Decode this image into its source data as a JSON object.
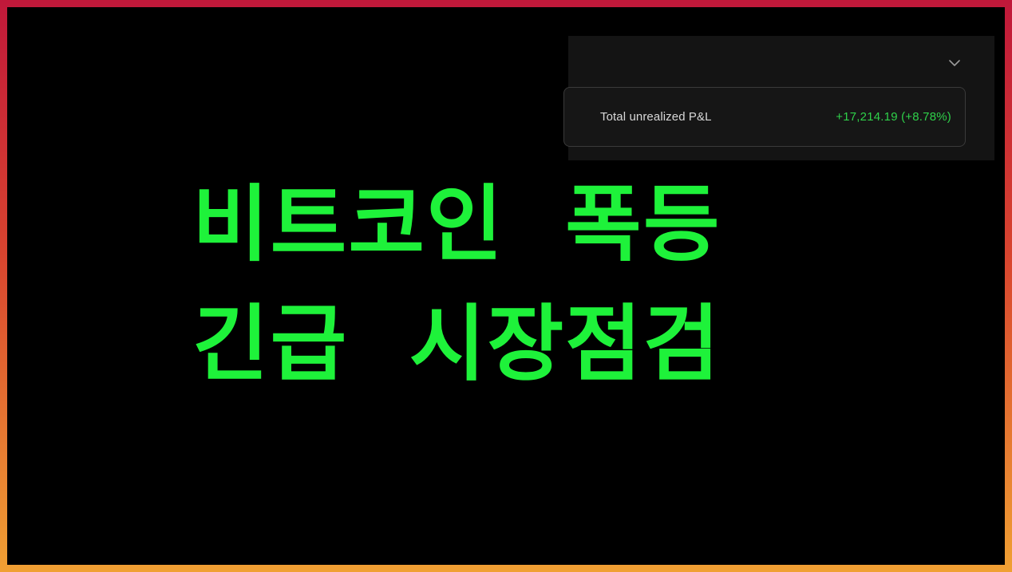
{
  "pnl_panel": {
    "label": "Total unrealized P&L",
    "value": "+17,214.19 (+8.78%)",
    "collapse_icon": "chevron-down-icon",
    "value_color": "#2fd14a"
  },
  "headline": {
    "line1": "비트코인  폭등",
    "line2": "긴급  시장점검",
    "color": "#1ef23a"
  },
  "frame": {
    "gradient_top": "#c0183a",
    "gradient_bottom": "#f0a033"
  }
}
